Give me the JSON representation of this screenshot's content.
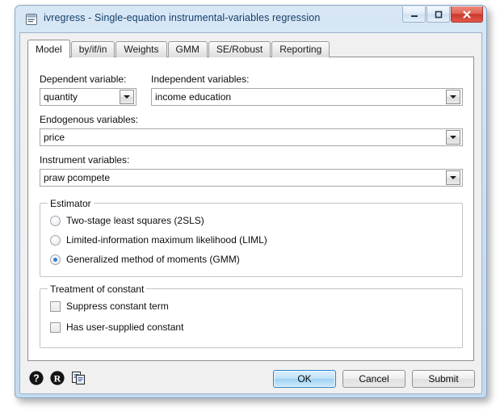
{
  "window": {
    "title": "ivregress - Single-equation instrumental-variables regression",
    "icon": "form-icon",
    "controls": {
      "minimize": "minimize-icon",
      "maximize": "maximize-icon",
      "close": "close-icon"
    }
  },
  "tabs": [
    {
      "label": "Model",
      "active": true
    },
    {
      "label": "by/if/in",
      "active": false
    },
    {
      "label": "Weights",
      "active": false
    },
    {
      "label": "GMM",
      "active": false
    },
    {
      "label": "SE/Robust",
      "active": false
    },
    {
      "label": "Reporting",
      "active": false
    }
  ],
  "fields": {
    "dependent": {
      "label": "Dependent variable:",
      "value": "quantity"
    },
    "independent": {
      "label": "Independent variables:",
      "value": "income education"
    },
    "endogenous": {
      "label": "Endogenous variables:",
      "value": "price"
    },
    "instrument": {
      "label": "Instrument variables:",
      "value": "praw pcompete"
    }
  },
  "estimator": {
    "legend": "Estimator",
    "options": [
      {
        "label": "Two-stage least squares (2SLS)",
        "selected": false
      },
      {
        "label": "Limited-information maximum likelihood (LIML)",
        "selected": false
      },
      {
        "label": "Generalized method of moments (GMM)",
        "selected": true
      }
    ]
  },
  "constant": {
    "legend": "Treatment of constant",
    "options": [
      {
        "label": "Suppress constant term",
        "checked": false
      },
      {
        "label": "Has user-supplied constant",
        "checked": false
      }
    ]
  },
  "toolbar": {
    "help": "help-icon",
    "reset": "reset-icon",
    "copy": "copy-icon"
  },
  "buttons": {
    "ok": "OK",
    "cancel": "Cancel",
    "submit": "Submit"
  },
  "colors": {
    "accent": "#2f7fd0",
    "title_text": "#14406b",
    "close_red": "#c8392c",
    "frame": "#cfe0f2"
  }
}
